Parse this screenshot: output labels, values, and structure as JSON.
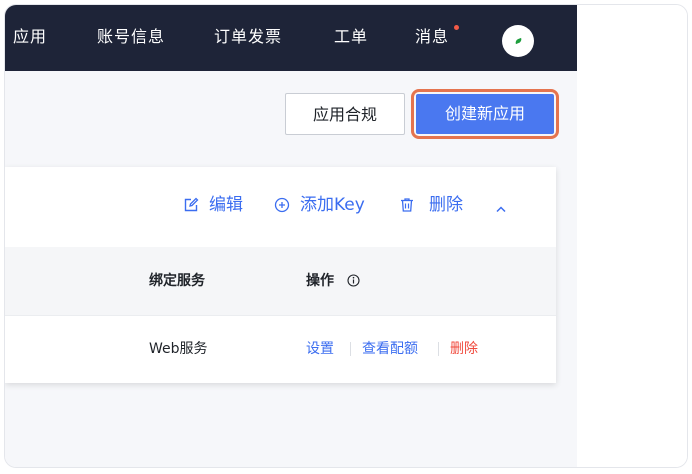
{
  "nav": {
    "items": [
      {
        "label": "应用"
      },
      {
        "label": "账号信息"
      },
      {
        "label": "订单发票"
      },
      {
        "label": "工单"
      },
      {
        "label": "消息"
      }
    ],
    "message_badge_color": "#f25a47"
  },
  "actions": {
    "compliance_label": "应用合规",
    "create_label": "创建新应用"
  },
  "card": {
    "toolbar": {
      "edit_label": "编辑",
      "add_key_label": "添加Key",
      "delete_label": "删除"
    },
    "table": {
      "headers": {
        "service": "绑定服务",
        "actions": "操作"
      },
      "rows": [
        {
          "service": "Web服务",
          "settings_link": "设置",
          "quota_link": "查看配额",
          "delete_link": "删除"
        }
      ]
    }
  },
  "colors": {
    "nav_bg": "#1e2438",
    "primary": "#4a78f0",
    "link": "#3b6df0",
    "danger": "#f04a3d",
    "highlight_ring": "#e5744f"
  }
}
